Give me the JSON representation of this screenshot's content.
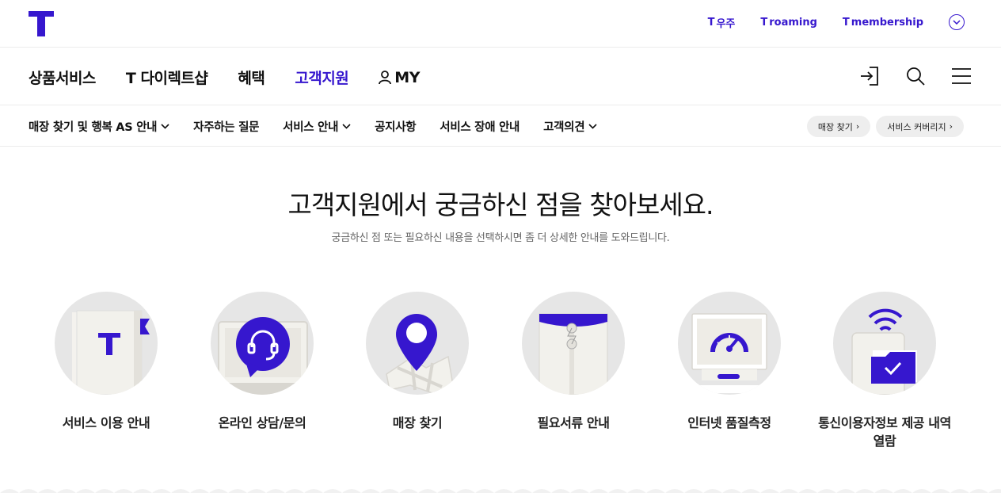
{
  "brand": {
    "accent": "#3617ce",
    "logo_icon": "t-logo-icon"
  },
  "util_links": [
    {
      "mark": "T",
      "label": "우주"
    },
    {
      "mark": "T",
      "label": "roaming"
    },
    {
      "mark": "T",
      "label": "membership"
    }
  ],
  "gnb": {
    "items": [
      {
        "label": "상품서비스"
      },
      {
        "label": "T 다이렉트샵"
      },
      {
        "label": "혜택"
      },
      {
        "label": "고객지원"
      },
      {
        "label": "MY"
      }
    ],
    "active_index": 3
  },
  "lnb": {
    "items": [
      {
        "label": "매장 찾기 및 행복 AS 안내",
        "dropdown": true
      },
      {
        "label": "자주하는 질문",
        "dropdown": false
      },
      {
        "label": "서비스 안내",
        "dropdown": true
      },
      {
        "label": "공지사항",
        "dropdown": false
      },
      {
        "label": "서비스 장애 안내",
        "dropdown": false
      },
      {
        "label": "고객의견",
        "dropdown": true
      }
    ],
    "quick": [
      {
        "label": "매장 찾기"
      },
      {
        "label": "서비스 커버리지"
      }
    ]
  },
  "hero": {
    "title": "고객지원에서 궁금하신 점을 찾아보세요.",
    "subtitle": "궁금하신 점 또는 필요하신 내용을 선택하시면 좀 더 상세한 안내를 도와드립니다."
  },
  "cards": [
    {
      "label": "서비스 이용 안내",
      "icon": "guide-book-icon"
    },
    {
      "label": "온라인 상담/문의",
      "icon": "headset-chat-icon"
    },
    {
      "label": "매장 찾기",
      "icon": "map-pin-icon"
    },
    {
      "label": "필요서류 안내",
      "icon": "document-envelope-icon"
    },
    {
      "label": "인터넷 품질측정",
      "icon": "speed-gauge-icon"
    },
    {
      "label": "통신이용자정보 제공 내역\n열람",
      "icon": "wifi-folder-icon"
    }
  ]
}
